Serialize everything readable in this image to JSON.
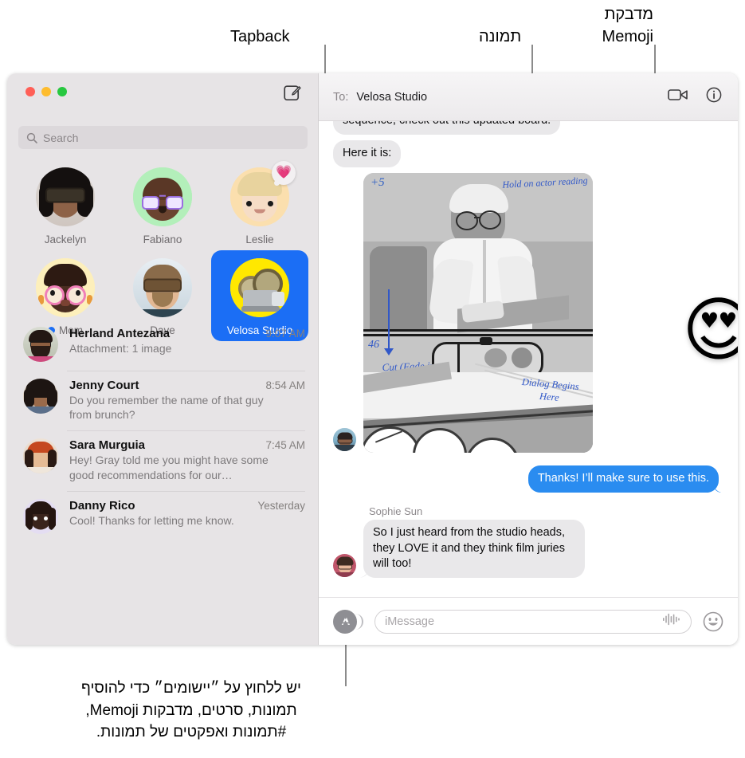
{
  "annotations": {
    "tapback": "Tapback",
    "photo": "תמונה",
    "memoji_sticker_line1": "מדבקת",
    "memoji_sticker_line2": "Memoji",
    "bottom_caption_line1": "יש ללחוץ על ״יישומים״ כדי להוסיף",
    "bottom_caption_line2": "תמונות, סרטים, מדבקות Memoji,",
    "bottom_caption_line3": "#תמונות ואפקטים של תמונות."
  },
  "window": {
    "traffic_lights": [
      "close",
      "minimize",
      "zoom"
    ],
    "compose_icon": "compose-icon"
  },
  "sidebar": {
    "search": {
      "placeholder": "Search",
      "icon": "search-icon"
    },
    "pinned": [
      {
        "name": "Jackelyn",
        "avatar": "photo-woman-sunglasses",
        "bg": "#d8d4d6",
        "glyph": "",
        "tapback": null,
        "unread": false,
        "selected": false
      },
      {
        "name": "Fabiano",
        "avatar": "memoji-man-purple-glasses",
        "bg": "#b3efba",
        "glyph": "🧑🏿‍🦲",
        "tapback": null,
        "unread": false,
        "selected": false
      },
      {
        "name": "Leslie",
        "avatar": "memoji-blond-curly",
        "bg": "#fbdfae",
        "glyph": "👦🏼",
        "tapback": "💗",
        "unread": false,
        "selected": false
      },
      {
        "name": "Mom",
        "avatar": "memoji-woman-pink-glasses",
        "bg": "#fdefbb",
        "glyph": "👩🏿",
        "tapback": null,
        "unread": true,
        "selected": false
      },
      {
        "name": "Dave",
        "avatar": "photo-man-sunglasses",
        "bg": "#dfe9ef",
        "glyph": "",
        "tapback": null,
        "unread": false,
        "selected": false
      },
      {
        "name": "Velosa Studio",
        "avatar": "film-projector",
        "bg": "#ffe800",
        "glyph": "📽️",
        "tapback": null,
        "unread": false,
        "selected": true
      }
    ],
    "conversations": [
      {
        "name": "Herland Antezana",
        "time": "9:07 AM",
        "preview": "Attachment: 1 image",
        "avatar": "photo-man-glasses-beard"
      },
      {
        "name": "Jenny Court",
        "time": "8:54 AM",
        "preview": "Do you remember the name of that guy from brunch?",
        "avatar": "photo-woman-curly"
      },
      {
        "name": "Sara Murguia",
        "time": "7:45 AM",
        "preview": "Hey! Gray told me you might have some good recommendations for our…",
        "avatar": "photo-woman-headband"
      },
      {
        "name": "Danny Rico",
        "time": "Yesterday",
        "preview": "Cool! Thanks for letting me know.",
        "avatar": "memoji-man-locs"
      }
    ]
  },
  "conversation": {
    "to_label": "To:",
    "recipient": "Velosa Studio",
    "actions": [
      {
        "name": "facetime-video-button",
        "icon": "video-camera-icon"
      },
      {
        "name": "details-button",
        "icon": "info-circle-icon"
      }
    ],
    "messages": [
      {
        "type": "incoming",
        "text": "sequence, check out this updated board.",
        "clipped": true
      },
      {
        "type": "incoming",
        "text": "Here it is:"
      },
      {
        "type": "attachment",
        "name": "storyboard-image",
        "annotations": [
          "+5",
          "Hold on actor reading",
          "46",
          "Cut (Fade in)",
          "Dialog Begins Here"
        ],
        "sticker": "😍"
      },
      {
        "type": "outgoing",
        "text": "Thanks! I’ll make sure to use this."
      },
      {
        "type": "incoming",
        "sender": "Sophie Sun",
        "text": "So I just heard from the studio heads, they LOVE it and they think film juries will too!"
      }
    ]
  },
  "composer": {
    "apps_button": "apps-button",
    "input_placeholder": "iMessage",
    "audio_icon": "audio-waveform-icon",
    "emoji_icon": "emoji-smiley-icon"
  },
  "colors": {
    "accent_blue": "#1b6ef5",
    "bubble_out": "#2a8cf0",
    "bubble_in": "#e9e8ea",
    "sidebar_bg": "#e7e4e6",
    "tapback_pink": "#ff4d88"
  }
}
